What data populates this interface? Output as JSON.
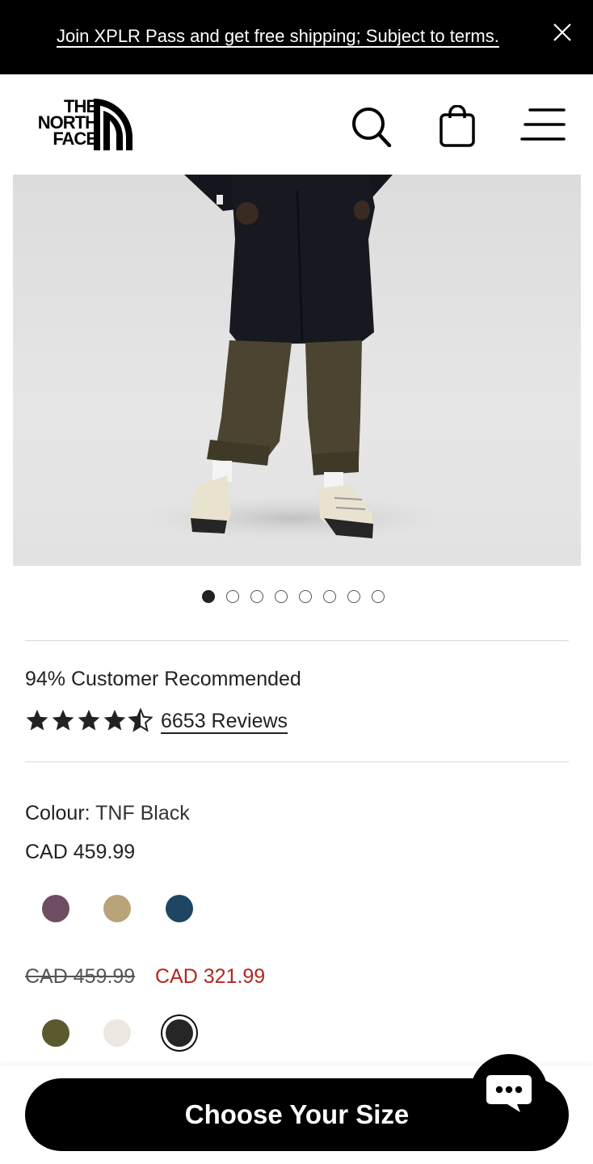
{
  "promo": {
    "text": "Join XPLR Pass and get free shipping; Subject to terms."
  },
  "header": {
    "logo_text": "THE NORTH FACE",
    "logo_lines": [
      "THE",
      "NORTH",
      "FACE"
    ],
    "icons": [
      "search-icon",
      "shopping-bag-icon",
      "menu-icon"
    ]
  },
  "gallery": {
    "image_count": 8,
    "active_index": 0
  },
  "rating": {
    "recommended": "94% Customer Recommended",
    "stars": 4.5,
    "reviews_label": "6653 Reviews"
  },
  "colour": {
    "label": "Colour:",
    "value": "TNF Black"
  },
  "price_group_1": {
    "price": "CAD 459.99",
    "swatches": [
      "#6e4d63",
      "#b9a37b",
      "#1d4663"
    ]
  },
  "price_group_2": {
    "original": "CAD 459.99",
    "sale": "CAD 321.99",
    "swatches": [
      "#5a5a2e",
      "#ece8df",
      "#262626"
    ],
    "selected_index": 2
  },
  "cta": {
    "label": "Choose Your Size"
  },
  "colors": {
    "sale": "#b0281f",
    "brand": "#000000"
  }
}
